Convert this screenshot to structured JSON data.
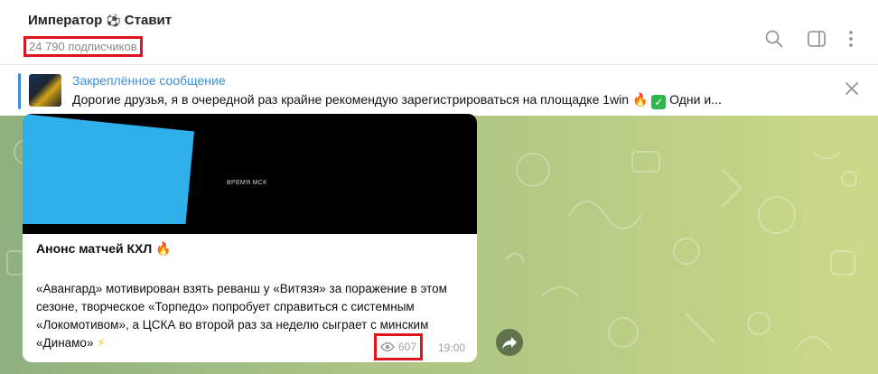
{
  "header": {
    "channel_title": "Император",
    "channel_title_emoji": "⚽",
    "channel_title_suffix": "Ставит",
    "subscribers": "24 790 подписчиков",
    "icons": [
      "search-icon",
      "sidebar-toggle-icon",
      "more-vertical-icon"
    ]
  },
  "pinned": {
    "title": "Закреплённое сообщение",
    "text": "Дорогие друзья, я в очередной раз крайне рекомендую зарегистрироваться на площадке 1win",
    "fire_emoji": "🔥",
    "check_emoji": "✓",
    "text_tail": "Одни и..."
  },
  "message": {
    "media_caption": "ВРЕМЯ МСК",
    "title": "Анонс матчей КХЛ",
    "title_emoji": "🔥",
    "body": "«Авангард» мотивирован взять реванш у «Витязя» за поражение в этом сезоне, творческое «Торпедо» попробует справиться с системным «Локомотивом», а ЦСКА во второй раз за неделю сыграет с минским «Динамо»",
    "body_emoji": "⚡",
    "views": "607",
    "time": "19:00"
  },
  "colors": {
    "accent": "#3a8fd8",
    "highlight": "#e0141c",
    "media_panel": "#2fb0ea"
  }
}
